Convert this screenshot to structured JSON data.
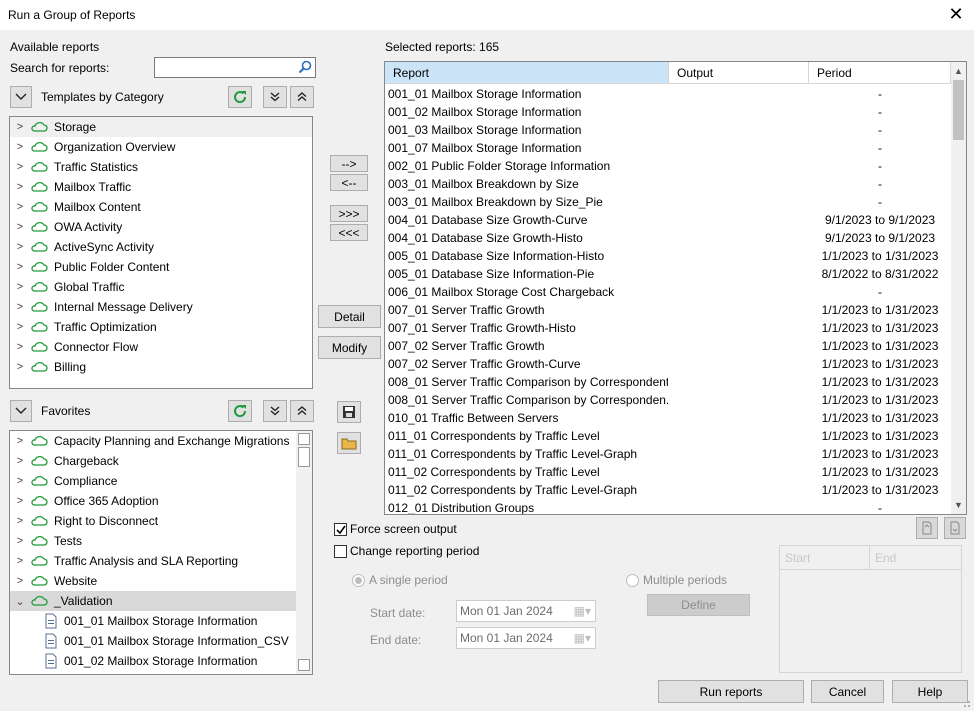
{
  "window": {
    "title": "Run a Group of Reports",
    "close_glyph": "✕"
  },
  "left": {
    "available_label": "Available reports",
    "search_label": "Search for reports:",
    "search_value": "",
    "templates_header": "Templates by Category",
    "templates": [
      "Storage",
      "Organization Overview",
      "Traffic Statistics",
      "Mailbox Traffic",
      "Mailbox Content",
      "OWA Activity",
      "ActiveSync Activity",
      "Public Folder Content",
      "Global Traffic",
      "Internal Message Delivery",
      "Traffic Optimization",
      "Connector Flow",
      "Billing"
    ],
    "favorites_header": "Favorites",
    "favorites": [
      "Capacity Planning and Exchange Migrations",
      "Chargeback",
      "Compliance",
      "Office 365 Adoption",
      "Right to Disconnect",
      "Tests",
      "Traffic Analysis and SLA Reporting",
      "Website",
      "_Validation"
    ],
    "validation_children": [
      "001_01 Mailbox Storage Information",
      "001_01 Mailbox Storage Information_CSV",
      "001_02 Mailbox Storage Information"
    ]
  },
  "middle": {
    "add": "-->",
    "remove": "<--",
    "add_all": ">>>",
    "remove_all": "<<<",
    "detail": "Detail",
    "modify": "Modify"
  },
  "right": {
    "selected_label": "Selected reports: 165",
    "columns": [
      "Report",
      "Output",
      "Period"
    ],
    "rows": [
      [
        "001_01 Mailbox Storage Information",
        "",
        "-"
      ],
      [
        "001_02 Mailbox Storage Information",
        "",
        "-"
      ],
      [
        "001_03 Mailbox Storage Information",
        "",
        "-"
      ],
      [
        "001_07 Mailbox Storage Information",
        "",
        "-"
      ],
      [
        "002_01 Public Folder Storage Information",
        "",
        "-"
      ],
      [
        "003_01 Mailbox Breakdown by Size",
        "",
        "-"
      ],
      [
        "003_01 Mailbox Breakdown by Size_Pie",
        "",
        "-"
      ],
      [
        "004_01 Database Size Growth-Curve",
        "",
        "9/1/2023 to 9/1/2023"
      ],
      [
        "004_01 Database Size Growth-Histo",
        "",
        "9/1/2023 to 9/1/2023"
      ],
      [
        "005_01 Database Size Information-Histo",
        "",
        "1/1/2023 to 1/31/2023"
      ],
      [
        "005_01 Database Size Information-Pie",
        "",
        "8/1/2022 to 8/31/2022"
      ],
      [
        "006_01 Mailbox Storage Cost Chargeback",
        "",
        "-"
      ],
      [
        "007_01 Server Traffic Growth",
        "",
        "1/1/2023 to 1/31/2023"
      ],
      [
        "007_01 Server Traffic Growth-Histo",
        "",
        "1/1/2023 to 1/31/2023"
      ],
      [
        "007_02 Server Traffic Growth",
        "",
        "1/1/2023 to 1/31/2023"
      ],
      [
        "007_02 Server Traffic Growth-Curve",
        "",
        "1/1/2023 to 1/31/2023"
      ],
      [
        "008_01 Server Traffic Comparison by Correspondent",
        "",
        "1/1/2023 to 1/31/2023"
      ],
      [
        "008_01 Server Traffic Comparison by Corresponden...",
        "",
        "1/1/2023 to 1/31/2023"
      ],
      [
        "010_01 Traffic Between Servers",
        "",
        "1/1/2023 to 1/31/2023"
      ],
      [
        "011_01 Correspondents by Traffic Level",
        "",
        "1/1/2023 to 1/31/2023"
      ],
      [
        "011_01 Correspondents by Traffic Level-Graph",
        "",
        "1/1/2023 to 1/31/2023"
      ],
      [
        "011_02 Correspondents by Traffic Level",
        "",
        "1/1/2023 to 1/31/2023"
      ],
      [
        "011_02 Correspondents by Traffic Level-Graph",
        "",
        "1/1/2023 to 1/31/2023"
      ],
      [
        "012_01 Distribution Groups",
        "",
        "-"
      ]
    ],
    "force_screen_output": "Force screen output",
    "change_period": "Change reporting period",
    "single_period": "A single period",
    "multiple_periods": "Multiple periods",
    "start_date_label": "Start date:",
    "end_date_label": "End date:",
    "start_date": "Mon 01  Jan  2024",
    "end_date": "Mon 01  Jan  2024",
    "define": "Define",
    "period_cols": [
      "Start",
      "End"
    ]
  },
  "footer": {
    "run": "Run reports",
    "cancel": "Cancel",
    "help": "Help"
  }
}
